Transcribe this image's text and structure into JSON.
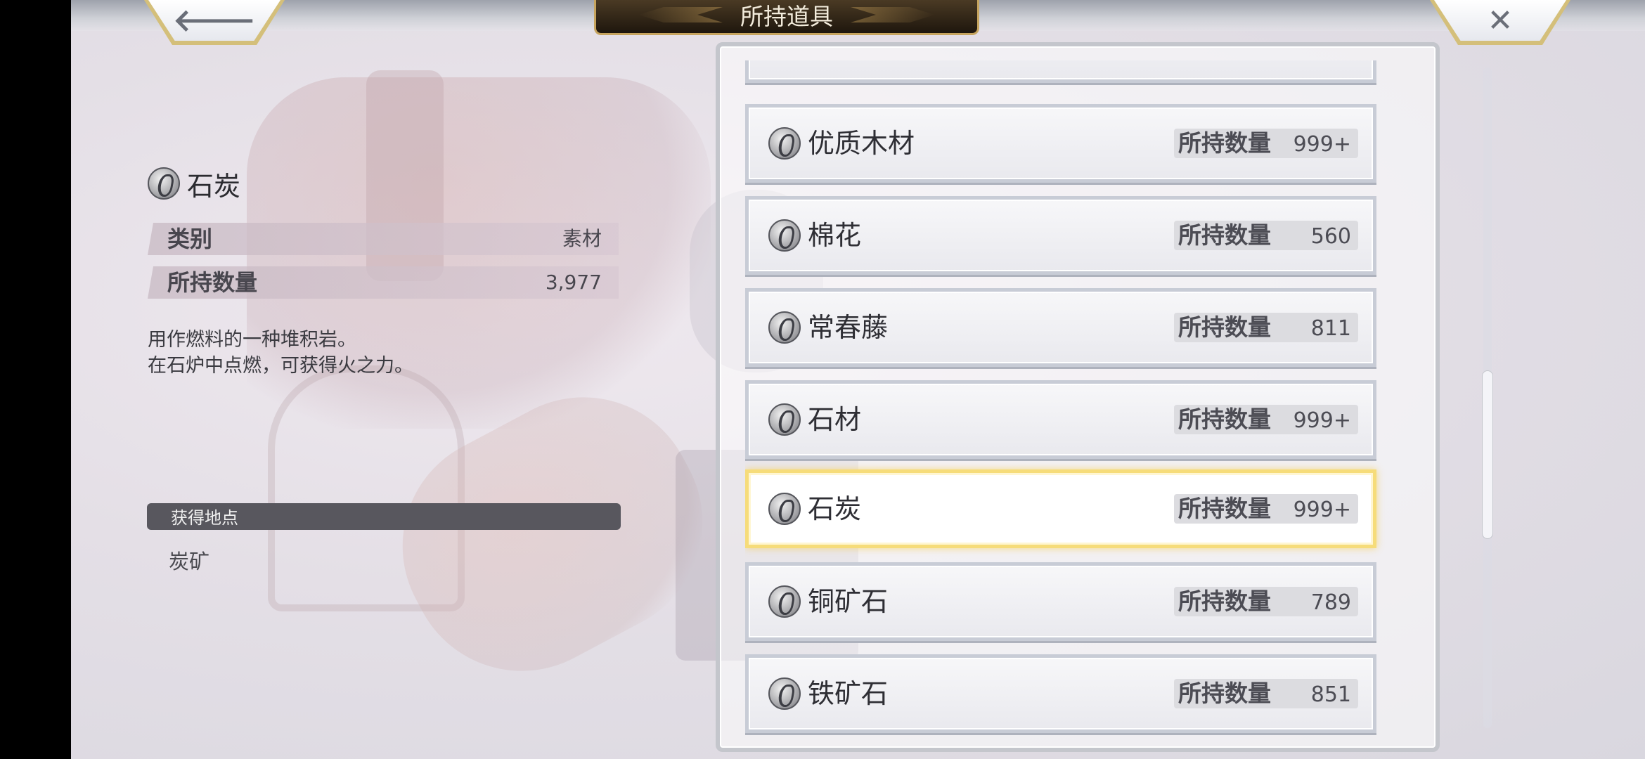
{
  "header": {
    "title": "所持道具",
    "back_glyph": "🡐",
    "close_glyph": "✕"
  },
  "detail": {
    "icon": "item-rune-icon",
    "name": "石炭",
    "category_label": "类别",
    "category_value": "素材",
    "owned_label": "所持数量",
    "owned_value": "3,977",
    "description": "用作燃料的一种堆积岩。\n在石炉中点燃，可获得火之力。",
    "source_header": "获得地点",
    "source_items": [
      "炭矿"
    ]
  },
  "inventory": {
    "qty_label": "所持数量",
    "selected_index": 5,
    "items": [
      {
        "name": "",
        "qty": ""
      },
      {
        "name": "优质木材",
        "qty": "999+"
      },
      {
        "name": "棉花",
        "qty": "560"
      },
      {
        "name": "常春藤",
        "qty": "811"
      },
      {
        "name": "石材",
        "qty": "999+"
      },
      {
        "name": "石炭",
        "qty": "999+"
      },
      {
        "name": "铜矿石",
        "qty": "789"
      },
      {
        "name": "铁矿石",
        "qty": "851"
      }
    ]
  },
  "colors": {
    "selected_border": "#f6dc7a",
    "title_plate": "#2a1f14",
    "title_plate_trim": "#c6a45e"
  }
}
